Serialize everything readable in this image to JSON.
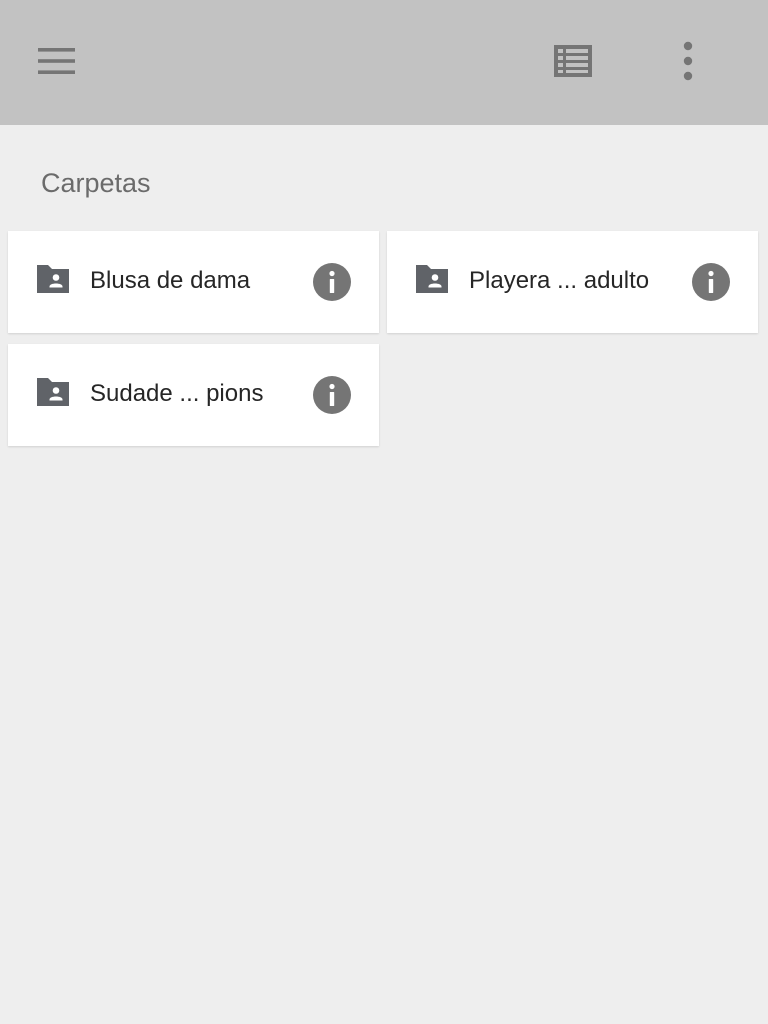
{
  "toolbar": {
    "menu_icon": "hamburger-menu-icon",
    "view_icon": "list-view-icon",
    "more_icon": "more-vertical-icon",
    "background": "#c2c2c2"
  },
  "section": {
    "title": "Carpetas"
  },
  "folders": [
    {
      "name": "Blusa de dama",
      "icon": "shared-folder-icon",
      "info_icon": "info-icon"
    },
    {
      "name": "Playera ... adulto",
      "icon": "shared-folder-icon",
      "info_icon": "info-icon"
    },
    {
      "name": "Sudade ... pions",
      "icon": "shared-folder-icon",
      "info_icon": "info-icon"
    }
  ],
  "colors": {
    "icon": "#606368",
    "info": "#757575",
    "page_bg": "#eeeeee",
    "card_bg": "#ffffff"
  }
}
